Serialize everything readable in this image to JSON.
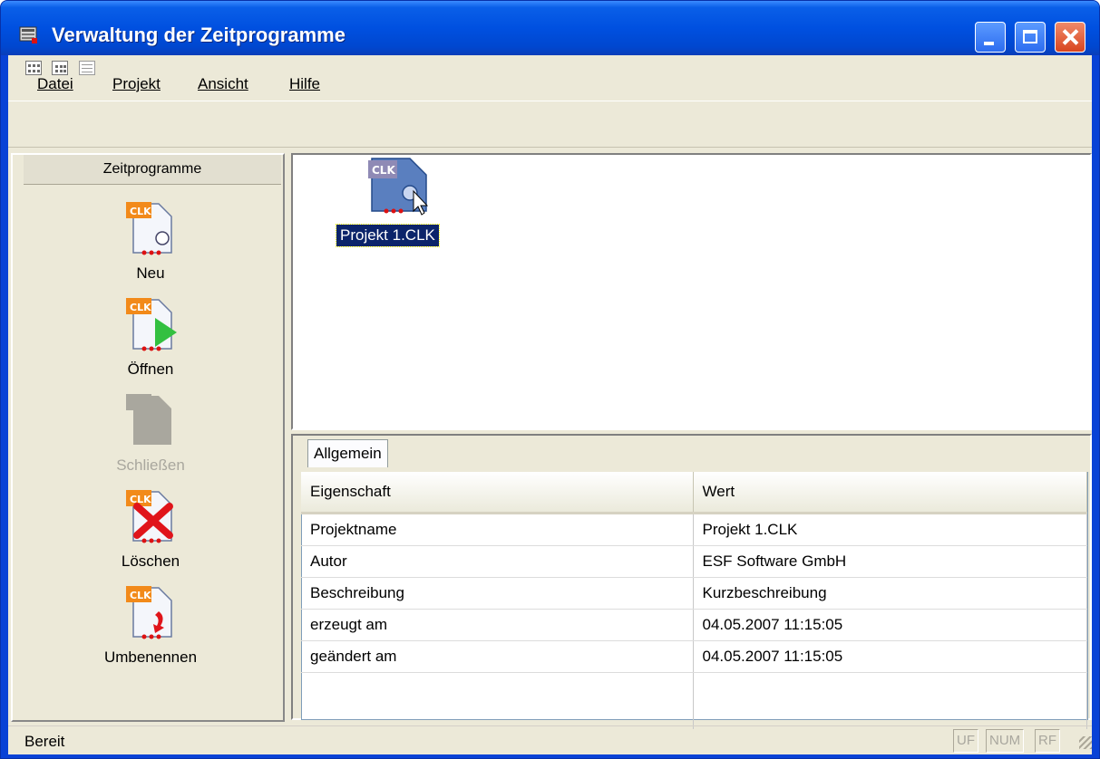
{
  "window": {
    "title": "Verwaltung der Zeitprogramme"
  },
  "menu": [
    {
      "label": "Datei"
    },
    {
      "label": "Projekt"
    },
    {
      "label": "Ansicht"
    },
    {
      "label": "Hilfe"
    }
  ],
  "toolbar": {
    "icons": [
      "large-icons-view",
      "small-icons-view",
      "details-view"
    ]
  },
  "left_panel": {
    "header": "Zeitprogramme",
    "buttons": [
      {
        "label": "Neu",
        "enabled": true,
        "icon": "new-file-icon"
      },
      {
        "label": "Öffnen",
        "enabled": true,
        "icon": "open-file-icon"
      },
      {
        "label": "Schließen",
        "enabled": false,
        "icon": "close-file-icon"
      },
      {
        "label": "Löschen",
        "enabled": true,
        "icon": "delete-file-icon"
      },
      {
        "label": "Umbenennen",
        "enabled": true,
        "icon": "rename-file-icon"
      }
    ]
  },
  "file_view": {
    "items": [
      {
        "label": "Projekt 1.CLK",
        "selected": true,
        "icon": "clk-file-icon"
      }
    ]
  },
  "properties": {
    "tab": "Allgemein",
    "columns": [
      "Eigenschaft",
      "Wert"
    ],
    "rows": [
      [
        "Projektname",
        "Projekt 1.CLK"
      ],
      [
        "Autor",
        "ESF Software GmbH"
      ],
      [
        "Beschreibung",
        "Kurzbeschreibung"
      ],
      [
        "erzeugt am",
        "04.05.2007 11:15:05"
      ],
      [
        "geändert am",
        "04.05.2007 11:15:05"
      ]
    ]
  },
  "statusbar": {
    "text": "Bereit",
    "indicators": [
      "UF",
      "NUM",
      "RF"
    ]
  }
}
